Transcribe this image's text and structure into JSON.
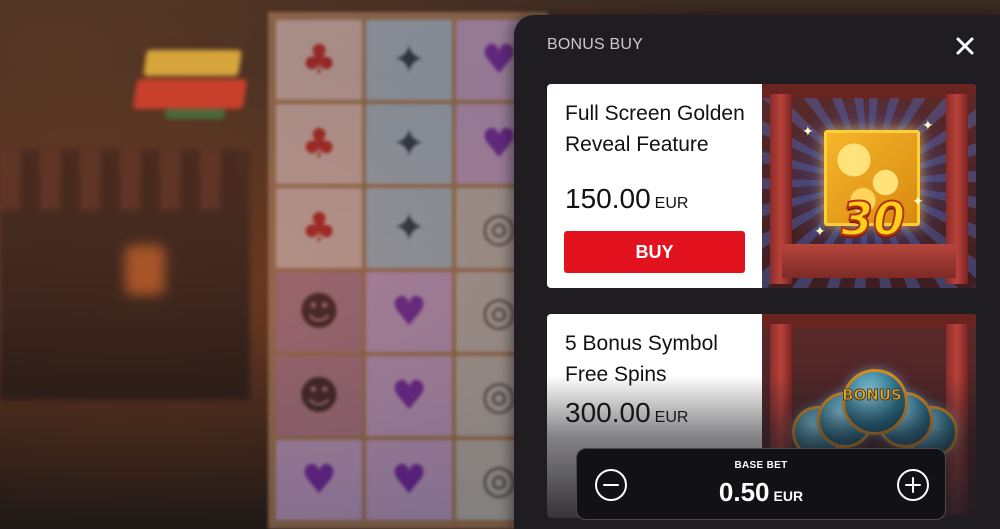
{
  "panel": {
    "title": "BONUS BUY",
    "close_icon": "close-icon"
  },
  "features": [
    {
      "name": "Full Screen Golden Reveal Feature",
      "price": "150.00",
      "currency": "EUR",
      "buy_label": "BUY",
      "art_badge": "30"
    },
    {
      "name": "5 Bonus Symbol Free Spins",
      "price": "300.00",
      "currency": "EUR",
      "art_badge": "BONUS"
    }
  ],
  "bet": {
    "label": "BASE BET",
    "value": "0.50",
    "currency": "EUR",
    "decrease_icon": "minus-circle-icon",
    "increase_icon": "plus-circle-icon"
  },
  "colors": {
    "panel_bg": "#1f1d22",
    "buy_button": "#e3121f",
    "card_bg": "#ffffff",
    "bet_bg": "#121115"
  }
}
